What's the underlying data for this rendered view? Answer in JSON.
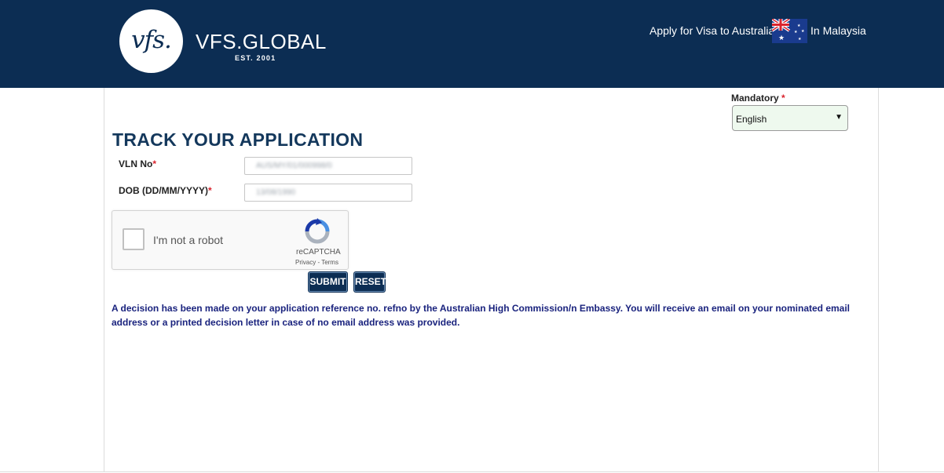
{
  "header": {
    "logo_mark": "vfs.",
    "brand_name": "VFS.GLOBAL",
    "established": "EST. 2001",
    "apply_text": "Apply for Visa to Australia",
    "location_text": "In Malaysia",
    "flag": "australia-flag",
    "colors": {
      "header_bg": "#0c2d53"
    }
  },
  "language": {
    "mandatory_label": "Mandatory",
    "required_marker": "*",
    "selected": "English"
  },
  "form": {
    "title": "TRACK YOUR APPLICATION",
    "vln_label": "VLN No",
    "vln_value": "AUS/MY/01/000998/0",
    "dob_label": "DOB (DD/MM/YYYY)",
    "dob_value": "13/08/1990",
    "required_marker": "*"
  },
  "captcha": {
    "label": "I'm not a robot",
    "brand": "reCAPTCHA",
    "links": "Privacy - Terms"
  },
  "buttons": {
    "submit": "SUBMIT",
    "reset": "RESET"
  },
  "message": "A decision has been made on your application reference no. refno by the Australian High Commission/n Embassy. You will receive an email on your nominated email address or a printed decision letter in case of no email address was provided."
}
